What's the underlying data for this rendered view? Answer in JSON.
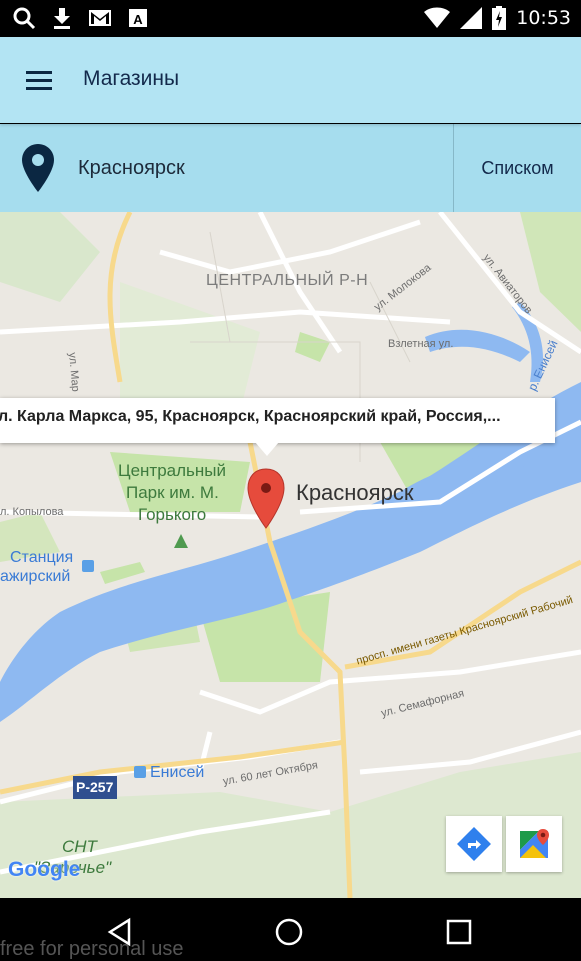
{
  "statusbar": {
    "time": "10:53",
    "icons": [
      "search-icon",
      "download-icon",
      "gmail-icon",
      "book-icon",
      "wifi-icon",
      "signal-icon",
      "battery-icon"
    ]
  },
  "appbar": {
    "title": "Магазины",
    "menu_icon": "hamburger-menu-icon"
  },
  "location": {
    "city": "Красноярск",
    "list_button": "Списком",
    "pin_icon": "location-pin-icon"
  },
  "map": {
    "district": "ЦЕНТРАЛЬНЫЙ Р-Н",
    "street_molokova": "ул. Молокова",
    "street_aviatorov": "ул. Авиаторов",
    "street_vzletnaya": "Взлетная ул.",
    "river_enisey": "р. Енисей",
    "street_markova": "ул. Мар",
    "park": [
      "Центральный",
      "Парк им. М.",
      "Горького"
    ],
    "city_label": "Красноярск",
    "street_kopylova": "л. Копылова",
    "station": [
      "Станция",
      "ажирский"
    ],
    "prospect": "просп. имени газеты Красноярский Рабочий",
    "street_semafornaya": "ул. Семафорная",
    "station_enisey": "Енисей",
    "street_60let": "ул. 60 лет Октября",
    "route": "Р-257",
    "snt": [
      "СНТ",
      "\"Заречье\""
    ],
    "google": "Google"
  },
  "infowindow": {
    "address": "л. Карла Маркса, 95, Красноярск, Красноярский край, Россия,..."
  },
  "map_buttons": {
    "directions_icon": "directions-icon",
    "maps_icon": "google-maps-icon"
  },
  "navbar": {
    "icons": [
      "back-icon",
      "home-icon",
      "recents-icon"
    ]
  },
  "watermark": "free for personal use",
  "colors": {
    "appbar": "#b3e4f3",
    "locbar": "#a6ddee",
    "water": "#8eb9f1",
    "park": "#c6e4a9",
    "marker": "#e64b3c"
  }
}
